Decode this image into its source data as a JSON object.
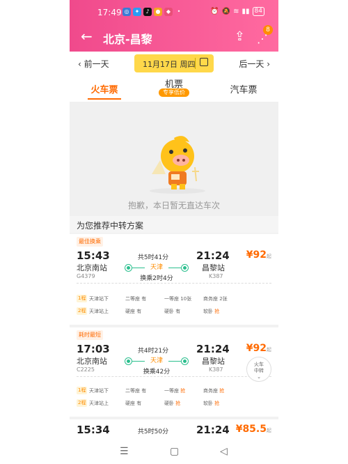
{
  "statusbar": {
    "time": "17:49",
    "battery": "84"
  },
  "header": {
    "title": "北京-昌黎",
    "badge": "8"
  },
  "datebar": {
    "prev": "前一天",
    "date": "11月17日 周四",
    "next": "后一天"
  },
  "tabs": [
    {
      "label": "火车票"
    },
    {
      "label": "机票",
      "badge": "专享低价"
    },
    {
      "label": "汽车票"
    }
  ],
  "empty": {
    "message": "抱歉，本日暂无直达车次"
  },
  "recommend": {
    "title": "为您推荐中转方案"
  },
  "cards": [
    {
      "tag": "最佳换乘",
      "dep_time": "15:43",
      "arr_time": "21:24",
      "duration": "共5时41分",
      "from": "北京南站",
      "to": "昌黎站",
      "via": "天津",
      "transfer": "换乘2时4分",
      "train1": "G4379",
      "train2": "K387",
      "price": "¥92",
      "price_suffix": "起",
      "segments": [
        {
          "no": "1程",
          "station": "天津站下",
          "c1": "二等座 有",
          "c2": "一等座 10张",
          "c3": "商务座 2张"
        },
        {
          "no": "2程",
          "station": "天津站上",
          "c1": "硬座 有",
          "c2": "硬卧 有",
          "c3_label": "软卧",
          "c3_val": "抢"
        }
      ]
    },
    {
      "tag": "耗时最短",
      "dep_time": "17:03",
      "arr_time": "21:24",
      "duration": "共4时21分",
      "from": "北京南站",
      "to": "昌黎站",
      "via": "天津",
      "transfer": "换乘42分",
      "train1": "C2225",
      "train2": "K387",
      "price": "¥92",
      "price_suffix": "起",
      "segments": [
        {
          "no": "1程",
          "station": "天津站下",
          "c1": "二等座 有",
          "c2_label": "一等座",
          "c2_val": "抢",
          "c3_label": "商务座",
          "c3_val": "抢"
        },
        {
          "no": "2程",
          "station": "天津站上",
          "c1": "硬座 有",
          "c2_label": "硬卧",
          "c2_val": "抢",
          "c3_label": "软卧",
          "c3_val": "抢"
        }
      ]
    },
    {
      "dep_time": "15:34",
      "arr_time": "21:24",
      "duration": "共5时50分",
      "price": "¥85.5",
      "price_suffix": "起"
    }
  ],
  "float_button": {
    "line1": "火车",
    "line2": "中转"
  }
}
